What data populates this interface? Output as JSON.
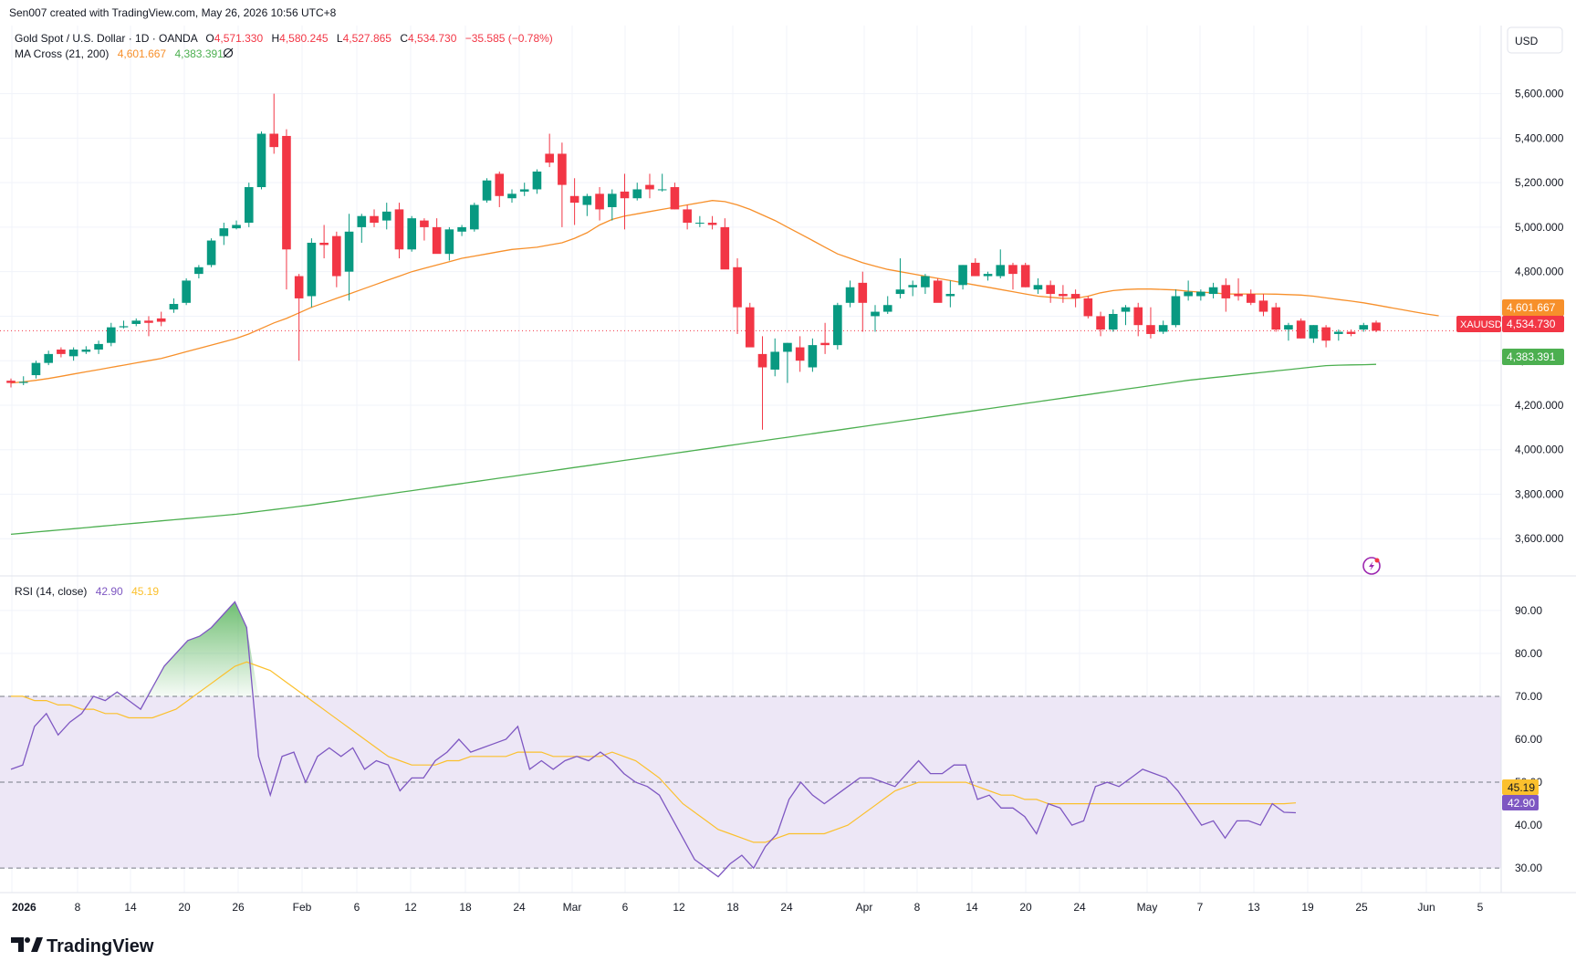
{
  "header": {
    "credit": "Sen007 created with TradingView.com, May 26, 2026 10:56 UTC+8",
    "symbol_line": "Gold Spot / U.S. Dollar · 1D · OANDA",
    "ohlc": {
      "o_label": "O",
      "o": "4,571.330",
      "h_label": "H",
      "h": "4,580.245",
      "l_label": "L",
      "l": "4,527.865",
      "c_label": "C",
      "c": "4,534.730",
      "change": "−35.585 (−0.78%)"
    },
    "ma_label": "MA Cross (21, 200)",
    "ma_fast_value": "4,601.667",
    "ma_slow_value": "4,383.391",
    "eye_icon": "eye-off-icon"
  },
  "currency": "USD",
  "price_axis": {
    "ticks": [
      "5,600.000",
      "5,400.000",
      "5,200.000",
      "5,000.000",
      "4,800.000",
      "4,600.000",
      "4,400.000",
      "4,200.000",
      "4,000.000",
      "3,800.000",
      "3,600.000"
    ],
    "min": 3560,
    "max": 5660
  },
  "price_badges": {
    "ma_fast": "4,601.667",
    "symbol_tag": "XAUUSD",
    "last": "4,534.730",
    "ma_slow": "4,383.391"
  },
  "rsi": {
    "label": "RSI (14, close)",
    "value": "42.90",
    "ma_value": "45.19",
    "ticks": [
      "90.00",
      "80.00",
      "70.00",
      "60.00",
      "50.00",
      "40.00",
      "30.00"
    ],
    "badge_ma": "45.19",
    "badge_rsi": "42.90"
  },
  "time_axis": [
    "2026",
    "8",
    "14",
    "20",
    "26",
    "Feb",
    "6",
    "12",
    "18",
    "24",
    "Mar",
    "6",
    "12",
    "18",
    "24",
    "Apr",
    "8",
    "14",
    "20",
    "24",
    "May",
    "7",
    "13",
    "19",
    "25",
    "Jun",
    "5"
  ],
  "logo": "TradingView",
  "colors": {
    "up": "#089981",
    "down": "#f23645",
    "ma_fast": "#f7902b",
    "ma_slow": "#4caf50",
    "rsi_line": "#7e57c2",
    "rsi_ma": "#fbc02d",
    "rsi_band": "#ede7f6"
  },
  "chart_data": {
    "type": "candlestick",
    "title": "Gold Spot / U.S. Dollar · 1D · OANDA",
    "x_range": [
      "2026-01-01",
      "2026-05-26"
    ],
    "y_range": [
      3560,
      5660
    ],
    "candles": [
      [
        "Jan 1",
        4310,
        4320,
        4280,
        4300
      ],
      [
        "Jan 2",
        4300,
        4330,
        4290,
        4305
      ],
      [
        "Jan 5",
        4335,
        4400,
        4320,
        4390
      ],
      [
        "Jan 6",
        4390,
        4445,
        4380,
        4430
      ],
      [
        "Jan 7",
        4450,
        4460,
        4415,
        4430
      ],
      [
        "Jan 8",
        4420,
        4460,
        4400,
        4450
      ],
      [
        "Jan 9",
        4440,
        4465,
        4430,
        4450
      ],
      [
        "Jan 12",
        4450,
        4490,
        4430,
        4475
      ],
      [
        "Jan 13",
        4480,
        4570,
        4465,
        4550
      ],
      [
        "Jan 14",
        4550,
        4580,
        4545,
        4555
      ],
      [
        "Jan 15",
        4565,
        4590,
        4555,
        4580
      ],
      [
        "Jan 16",
        4580,
        4600,
        4510,
        4570
      ],
      [
        "Jan 19",
        4590,
        4620,
        4555,
        4575
      ],
      [
        "Jan 20",
        4630,
        4680,
        4615,
        4655
      ],
      [
        "Jan 21",
        4660,
        4770,
        4650,
        4760
      ],
      [
        "Jan 22",
        4790,
        4830,
        4770,
        4820
      ],
      [
        "Jan 23",
        4830,
        4950,
        4820,
        4940
      ],
      [
        "Jan 26",
        4960,
        5020,
        4920,
        4995
      ],
      [
        "Jan 27",
        4995,
        5030,
        4990,
        5010
      ],
      [
        "Jan 28",
        5020,
        5200,
        5000,
        5180
      ],
      [
        "Jan 29",
        5180,
        5430,
        5170,
        5420
      ],
      [
        "Jan 30",
        5420,
        5600,
        5330,
        5360
      ],
      [
        "Feb 2",
        5410,
        5440,
        4720,
        4900
      ],
      [
        "Feb 3",
        4780,
        4790,
        4400,
        4680
      ],
      [
        "Feb 4",
        4690,
        4950,
        4640,
        4930
      ],
      [
        "Feb 5",
        4930,
        5010,
        4860,
        4920
      ],
      [
        "Feb 6",
        4960,
        4980,
        4730,
        4780
      ],
      [
        "Feb 9",
        4800,
        5060,
        4670,
        4980
      ],
      [
        "Feb 10",
        5000,
        5060,
        4930,
        5050
      ],
      [
        "Feb 11",
        5050,
        5080,
        5000,
        5020
      ],
      [
        "Feb 12",
        5030,
        5110,
        4990,
        5070
      ],
      [
        "Feb 13",
        5080,
        5110,
        4860,
        4900
      ],
      [
        "Feb 16",
        4900,
        5050,
        4890,
        5040
      ],
      [
        "Feb 17",
        5030,
        5040,
        4940,
        5000
      ],
      [
        "Feb 18",
        5000,
        5040,
        4920,
        4880
      ],
      [
        "Feb 19",
        4880,
        5000,
        4850,
        4990
      ],
      [
        "Feb 20",
        4980,
        5010,
        4960,
        5000
      ],
      [
        "Feb 23",
        4990,
        5110,
        4980,
        5100
      ],
      [
        "Feb 24",
        5120,
        5220,
        5110,
        5210
      ],
      [
        "Feb 25",
        5240,
        5250,
        5090,
        5140
      ],
      [
        "Feb 26",
        5130,
        5170,
        5110,
        5150
      ],
      [
        "Feb 27",
        5160,
        5200,
        5140,
        5170
      ],
      [
        "Mar 2",
        5170,
        5260,
        5150,
        5250
      ],
      [
        "Mar 3",
        5330,
        5420,
        5270,
        5290
      ],
      [
        "Mar 4",
        5330,
        5380,
        5000,
        5190
      ],
      [
        "Mar 5",
        5140,
        5220,
        5010,
        5110
      ],
      [
        "Mar 6",
        5100,
        5150,
        5050,
        5140
      ],
      [
        "Mar 9",
        5150,
        5180,
        5030,
        5080
      ],
      [
        "Mar 10",
        5090,
        5170,
        5030,
        5150
      ],
      [
        "Mar 11",
        5160,
        5240,
        4990,
        5130
      ],
      [
        "Mar 12",
        5130,
        5200,
        5120,
        5170
      ],
      [
        "Mar 13",
        5190,
        5240,
        5130,
        5170
      ],
      [
        "Mar 16",
        5170,
        5240,
        5160,
        5170
      ],
      [
        "Mar 17",
        5180,
        5200,
        5080,
        5080
      ],
      [
        "Mar 18",
        5080,
        5100,
        4990,
        5020
      ],
      [
        "Mar 19",
        5020,
        5050,
        5000,
        5020
      ],
      [
        "Mar 20",
        5020,
        5050,
        4990,
        5010
      ],
      [
        "Mar 23",
        5000,
        5040,
        4960,
        4810
      ],
      [
        "Mar 24",
        4820,
        4860,
        4520,
        4640
      ],
      [
        "Mar 25",
        4640,
        4660,
        4500,
        4460
      ],
      [
        "Mar 26",
        4430,
        4510,
        4090,
        4370
      ],
      [
        "Mar 27",
        4360,
        4500,
        4330,
        4440
      ],
      [
        "Mar 30",
        4440,
        4480,
        4300,
        4480
      ],
      [
        "Mar 31",
        4460,
        4510,
        4350,
        4400
      ],
      [
        "Apr 1",
        4370,
        4500,
        4350,
        4470
      ],
      [
        "Apr 2",
        4480,
        4570,
        4430,
        4470
      ],
      [
        "Apr 3",
        4470,
        4660,
        4450,
        4650
      ],
      [
        "Apr 6",
        4660,
        4760,
        4640,
        4730
      ],
      [
        "Apr 7",
        4750,
        4800,
        4530,
        4660
      ],
      [
        "Apr 8",
        4600,
        4650,
        4530,
        4620
      ],
      [
        "Apr 9",
        4620,
        4690,
        4610,
        4650
      ],
      [
        "Apr 10",
        4700,
        4860,
        4680,
        4720
      ],
      [
        "Apr 13",
        4730,
        4760,
        4690,
        4740
      ],
      [
        "Apr 14",
        4730,
        4790,
        4700,
        4780
      ],
      [
        "Apr 15",
        4760,
        4770,
        4690,
        4660
      ],
      [
        "Apr 16",
        4690,
        4760,
        4640,
        4700
      ],
      [
        "Apr 17",
        4740,
        4830,
        4720,
        4830
      ],
      [
        "Apr 20",
        4840,
        4860,
        4780,
        4780
      ],
      [
        "Apr 21",
        4780,
        4800,
        4760,
        4790
      ],
      [
        "Apr 22",
        4780,
        4900,
        4770,
        4830
      ],
      [
        "Apr 23",
        4830,
        4840,
        4720,
        4790
      ],
      [
        "Apr 24",
        4830,
        4840,
        4730,
        4730
      ],
      [
        "Apr 27",
        4720,
        4770,
        4700,
        4740
      ],
      [
        "Apr 28",
        4740,
        4760,
        4660,
        4700
      ],
      [
        "Apr 29",
        4700,
        4740,
        4660,
        4690
      ],
      [
        "Apr 30",
        4700,
        4720,
        4640,
        4680
      ],
      [
        "May 1",
        4680,
        4690,
        4590,
        4600
      ],
      [
        "May 4",
        4600,
        4620,
        4510,
        4540
      ],
      [
        "May 5",
        4540,
        4630,
        4530,
        4610
      ],
      [
        "May 6",
        4620,
        4650,
        4560,
        4640
      ],
      [
        "May 7",
        4640,
        4660,
        4510,
        4560
      ],
      [
        "May 8",
        4560,
        4640,
        4500,
        4520
      ],
      [
        "May 11",
        4530,
        4580,
        4520,
        4560
      ],
      [
        "May 12",
        4560,
        4720,
        4550,
        4690
      ],
      [
        "May 13",
        4690,
        4760,
        4670,
        4710
      ],
      [
        "May 14",
        4690,
        4720,
        4670,
        4710
      ],
      [
        "May 15",
        4700,
        4750,
        4680,
        4730
      ],
      [
        "May 18",
        4740,
        4770,
        4620,
        4680
      ],
      [
        "May 19",
        4700,
        4770,
        4670,
        4690
      ],
      [
        "May 20",
        4700,
        4720,
        4650,
        4660
      ],
      [
        "May 21",
        4670,
        4700,
        4600,
        4620
      ],
      [
        "May 22",
        4640,
        4660,
        4530,
        4540
      ],
      [
        "May 25",
        4540,
        4570,
        4490,
        4560
      ],
      [
        "May 26",
        4580,
        4590,
        4500,
        4500
      ],
      [
        "May 27",
        4500,
        4560,
        4480,
        4560
      ],
      [
        "May 28",
        4550,
        4560,
        4460,
        4490
      ],
      [
        "May 29",
        4520,
        4540,
        4490,
        4530
      ],
      [
        "Jun 1",
        4530,
        4540,
        4510,
        4520
      ],
      [
        "Jun 2",
        4540,
        4570,
        4530,
        4560
      ],
      [
        "Jun 3",
        4571.33,
        4580.245,
        4527.865,
        4534.73
      ]
    ],
    "ma21": [
      4300,
      4305,
      4312,
      4320,
      4330,
      4340,
      4350,
      4360,
      4370,
      4380,
      4390,
      4400,
      4410,
      4425,
      4440,
      4455,
      4470,
      4485,
      4500,
      4520,
      4545,
      4570,
      4590,
      4615,
      4640,
      4660,
      4680,
      4700,
      4720,
      4740,
      4760,
      4780,
      4800,
      4815,
      4830,
      4845,
      4860,
      4870,
      4880,
      4890,
      4900,
      4905,
      4910,
      4920,
      4930,
      4950,
      4975,
      5010,
      5035,
      5050,
      5060,
      5070,
      5080,
      5090,
      5100,
      5110,
      5120,
      5115,
      5100,
      5080,
      5055,
      5030,
      5000,
      4970,
      4940,
      4910,
      4880,
      4860,
      4840,
      4825,
      4810,
      4800,
      4790,
      4780,
      4770,
      4760,
      4750,
      4740,
      4730,
      4720,
      4710,
      4700,
      4690,
      4685,
      4680,
      4680,
      4690,
      4705,
      4715,
      4720,
      4722,
      4722,
      4720,
      4718,
      4712,
      4708,
      4705,
      4700,
      4700,
      4700,
      4700,
      4699,
      4697,
      4695,
      4690,
      4682,
      4675,
      4668,
      4660,
      4650,
      4640,
      4630,
      4620,
      4610,
      4601.667
    ],
    "ma200": [
      3620,
      3625,
      3630,
      3635,
      3640,
      3645,
      3650,
      3655,
      3660,
      3665,
      3670,
      3675,
      3680,
      3685,
      3690,
      3695,
      3700,
      3705,
      3710,
      3717,
      3724,
      3731,
      3738,
      3745,
      3752,
      3760,
      3768,
      3776,
      3784,
      3792,
      3800,
      3808,
      3816,
      3824,
      3832,
      3840,
      3848,
      3856,
      3864,
      3872,
      3880,
      3888,
      3896,
      3904,
      3912,
      3920,
      3928,
      3936,
      3944,
      3952,
      3960,
      3968,
      3976,
      3984,
      3992,
      4000,
      4008,
      4016,
      4024,
      4032,
      4040,
      4048,
      4056,
      4064,
      4072,
      4080,
      4088,
      4096,
      4104,
      4112,
      4120,
      4128,
      4136,
      4144,
      4152,
      4160,
      4168,
      4176,
      4184,
      4192,
      4200,
      4208,
      4216,
      4224,
      4232,
      4240,
      4248,
      4256,
      4264,
      4272,
      4280,
      4288,
      4296,
      4304,
      4312,
      4318,
      4324,
      4330,
      4336,
      4342,
      4348,
      4354,
      4360,
      4366,
      4372,
      4378,
      4380,
      4381,
      4382,
      4383.391
    ],
    "rsi": [
      53,
      54,
      63,
      66,
      61,
      64,
      66,
      70,
      69,
      71,
      69,
      67,
      72,
      77,
      80,
      83,
      84,
      86,
      89,
      92,
      86,
      56,
      47,
      56,
      57,
      50,
      56,
      58,
      56,
      58,
      53,
      55,
      54,
      48,
      51,
      51,
      55,
      57,
      60,
      57,
      58,
      59,
      60,
      63,
      53,
      55,
      53,
      55,
      56,
      55,
      57,
      55,
      52,
      50,
      49,
      47,
      42,
      37,
      32,
      30,
      28,
      31,
      33,
      30,
      35,
      38,
      46,
      50,
      47,
      45,
      47,
      49,
      51,
      51,
      50,
      49,
      52,
      55,
      52,
      52,
      54,
      54,
      46,
      47,
      44,
      44,
      42,
      38,
      45,
      44,
      40,
      41,
      49,
      50,
      49,
      51,
      53,
      52,
      51,
      48,
      44,
      40,
      41,
      37,
      41,
      41,
      40,
      45,
      43,
      42.9
    ],
    "rsi_ma": [
      70,
      70,
      69,
      69,
      68,
      68,
      67,
      67,
      66,
      66,
      65,
      65,
      65,
      66,
      67,
      69,
      71,
      73,
      75,
      77,
      78,
      77,
      76,
      74,
      72,
      70,
      68,
      66,
      64,
      62,
      60,
      58,
      56,
      55,
      54,
      54,
      54,
      55,
      55,
      56,
      56,
      56,
      56,
      57,
      57,
      57,
      56,
      56,
      56,
      56,
      56,
      57,
      56,
      55,
      53,
      51,
      48,
      45,
      43,
      41,
      39,
      38,
      37,
      36,
      36,
      37,
      38,
      38,
      38,
      38,
      39,
      40,
      42,
      44,
      46,
      48,
      49,
      50,
      50,
      50,
      50,
      50,
      49,
      48,
      47,
      47,
      46,
      46,
      45,
      45,
      45,
      45,
      45,
      45,
      45,
      45,
      45,
      45,
      45,
      45,
      45,
      45,
      45,
      45,
      45,
      45,
      45,
      45,
      45,
      45.19
    ],
    "rsi_levels": {
      "overbought": 70,
      "middle": 50,
      "oversold": 30
    },
    "rsi_range": [
      26,
      94
    ]
  }
}
